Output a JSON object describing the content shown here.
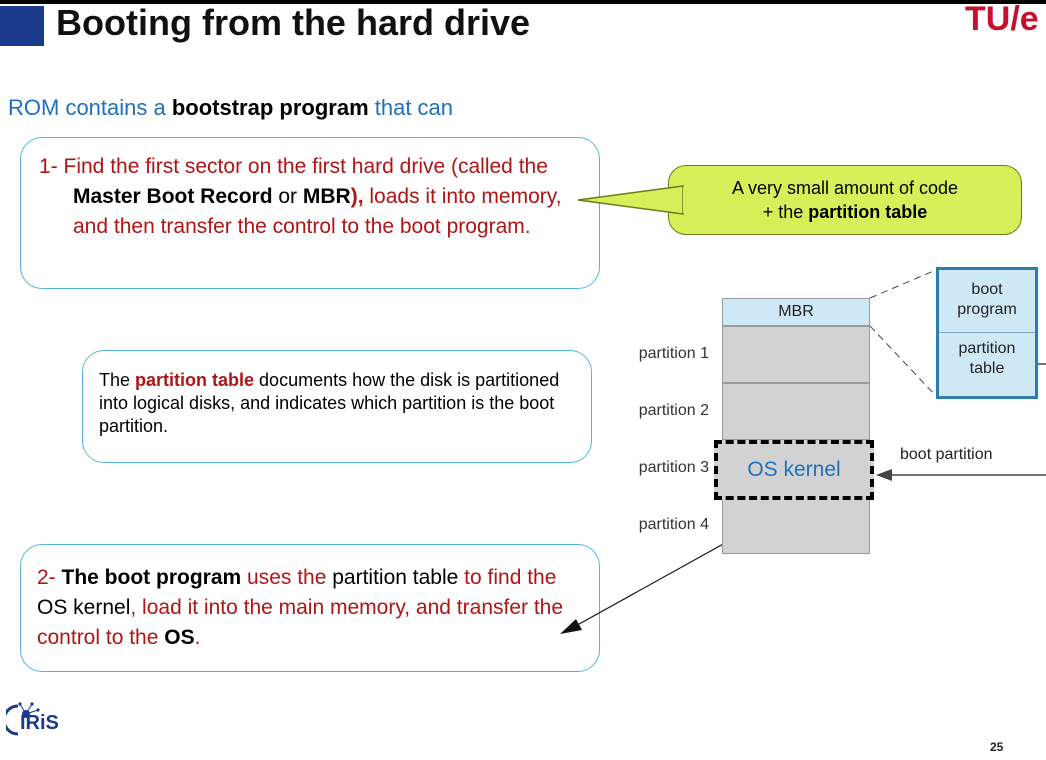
{
  "header": {
    "title": "Booting from the hard drive",
    "logo_left": "TU",
    "logo_sep": "/",
    "logo_right": "e"
  },
  "intro": {
    "part1": "ROM contains a ",
    "bold": "bootstrap program",
    "part2": " that can"
  },
  "box1": {
    "t1": "1- Find the first sector on the first hard drive (called the ",
    "b1": "Master Boot Record",
    "t2": " or ",
    "b2": "MBR",
    "t3": "),",
    "t4": " loads it into memory, and then transfer the control to the boot program."
  },
  "callout": {
    "line1": "A very small amount of code",
    "line2_prefix": "+ the ",
    "line2_bold": "partition table"
  },
  "box2": {
    "t1": "The ",
    "b1": "partition table",
    "t2": " documents how the disk is partitioned into logical disks, and indicates which partition is the boot partition."
  },
  "box3": {
    "t1": "2- ",
    "b1": "The boot program",
    "t2": " uses the ",
    "t3": "partition table",
    "t4": " to find the ",
    "t5": "OS",
    "t6": " kernel",
    "t7": ", load it into the main memory, and transfer the control to the ",
    "b2": "OS",
    "t8": "."
  },
  "diagram": {
    "mbr": "MBR",
    "partitions": [
      "partition 1",
      "partition 2",
      "partition 3",
      "partition 4"
    ],
    "os_kernel": "OS kernel",
    "boot_partition": "boot partition",
    "mbr_detail": {
      "top_line1": "boot",
      "top_line2": "program",
      "bottom_line1": "partition",
      "bottom_line2": "table"
    }
  },
  "footer": {
    "page_number": "25",
    "iris_label": "IRiS"
  },
  "colors": {
    "accent_blue": "#1f6fc0",
    "accent_red": "#b01515",
    "callout_fill": "#d7ef59",
    "box_border": "#55b7d8"
  }
}
